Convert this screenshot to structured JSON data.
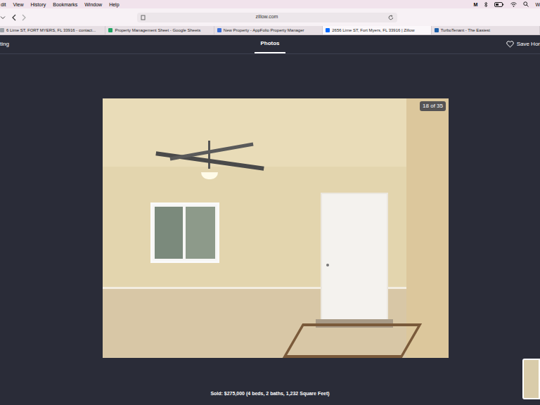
{
  "menu_bar": {
    "items": [
      "dit",
      "View",
      "History",
      "Bookmarks",
      "Window",
      "Help"
    ],
    "status": [
      "M",
      "W"
    ]
  },
  "toolbar": {
    "address": "zillow.com"
  },
  "tabs": [
    {
      "label": "6 Lime ST, FORT MYERS, FL 33916 - contact...",
      "selected": false,
      "color": "#9aa0a6"
    },
    {
      "label": "Property Management Sheet - Google Sheets",
      "selected": false,
      "color": "#1fa463"
    },
    {
      "label": "New Property - AppFolio Property Manager",
      "selected": false,
      "color": "#3b6fd8"
    },
    {
      "label": "2656 Lime ST, Fort Myers, FL 33916 | Zillow",
      "selected": true,
      "color": "#006aff"
    },
    {
      "label": "TurboTenant - The Easiest",
      "selected": false,
      "color": "#1d5fa8"
    }
  ],
  "page_header": {
    "left": "ting",
    "title": "Photos",
    "save": "Save Hor"
  },
  "photo": {
    "counter": "18 of 35"
  },
  "caption": "Sold: $275,000 (4 beds, 2 baths, 1,232 Square Feet)"
}
